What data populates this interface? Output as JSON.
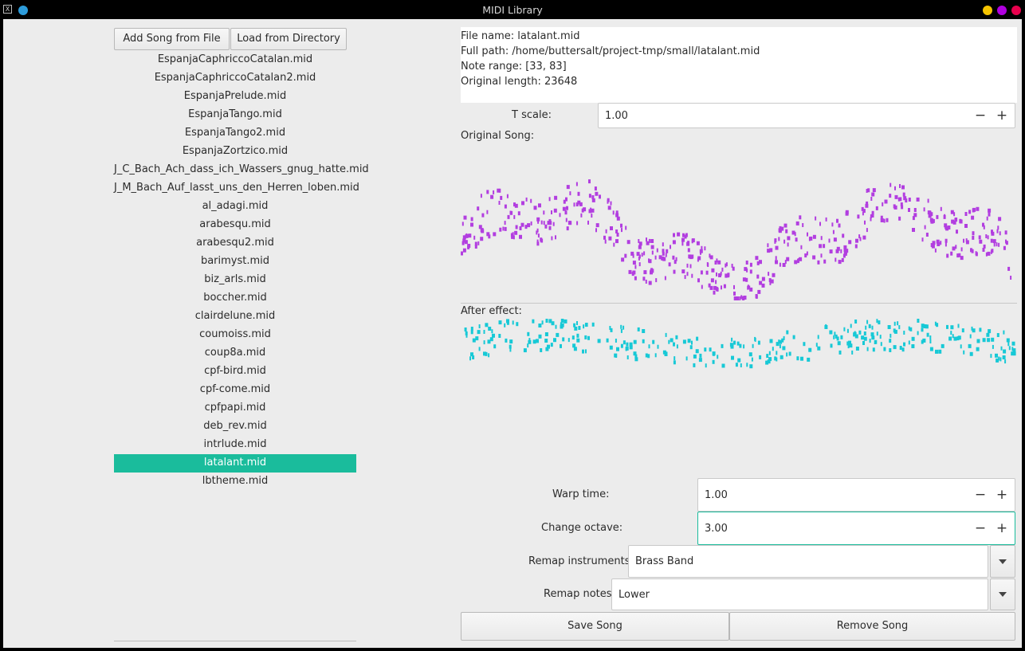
{
  "window": {
    "title": "MIDI Library",
    "app_icon": "X"
  },
  "titlebar_colors": {
    "left_dot": "#2d9cdb",
    "minimize": "#f5c400",
    "maximize": "#b000e0",
    "close": "#e8004d"
  },
  "toolbar": {
    "add_song_label": "Add Song from File",
    "load_dir_label": "Load from Directory"
  },
  "songs": [
    "EspanjaCaphriccoCatalan.mid",
    "EspanjaCaphriccoCatalan2.mid",
    "EspanjaPrelude.mid",
    "EspanjaTango.mid",
    "EspanjaTango2.mid",
    "EspanjaZortzico.mid",
    "J_C_Bach_Ach_dass_ich_Wassers_gnug_hatte.mid",
    "J_M_Bach_Auf_lasst_uns_den_Herren_loben.mid",
    "al_adagi.mid",
    "arabesqu.mid",
    "arabesqu2.mid",
    "barimyst.mid",
    "biz_arls.mid",
    "boccher.mid",
    "clairdelune.mid",
    "coumoiss.mid",
    "coup8a.mid",
    "cpf-bird.mid",
    "cpf-come.mid",
    "cpfpapi.mid",
    "deb_rev.mid",
    "intrlude.mid",
    "latalant.mid",
    "lbtheme.mid"
  ],
  "selected_song": "latalant.mid",
  "selected_color": "#1abc9c",
  "info": {
    "file_name": "File name: latalant.mid",
    "full_path": "Full path: /home/buttersalt/project-tmp/small/latalant.mid",
    "note_range": "Note range: [33, 83]",
    "original_length": "Original length: 23648"
  },
  "t_scale": {
    "label": "T scale:",
    "value": "1.00"
  },
  "original_song": {
    "label": "Original Song:",
    "color": "#b23ee0"
  },
  "after_effect": {
    "label": "After effect:",
    "color": "#17c9d6"
  },
  "warp_time": {
    "label": "Warp time:",
    "value": "1.00"
  },
  "change_octave": {
    "label": "Change octave:",
    "value": "3.00"
  },
  "remap_instruments": {
    "label": "Remap instruments:",
    "value": "Brass Band"
  },
  "remap_notes": {
    "label": "Remap notes:",
    "value": "Lower"
  },
  "actions": {
    "save_label": "Save Song",
    "remove_label": "Remove Song"
  },
  "spin_symbols": {
    "minus": "−",
    "plus": "+"
  }
}
